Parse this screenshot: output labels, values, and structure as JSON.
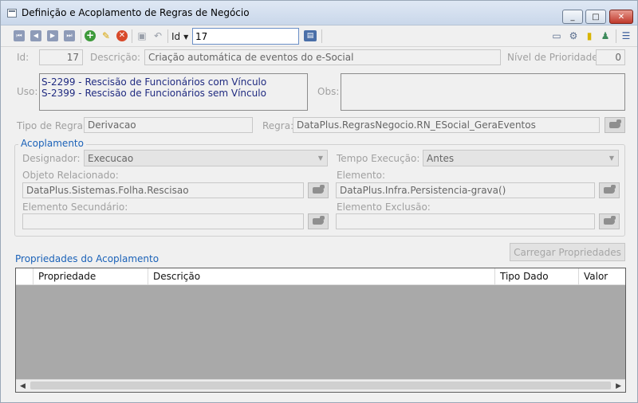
{
  "window": {
    "title": "Definição e Acoplamento de Regras de Negócio",
    "controls": {
      "minimize": "_",
      "maximize": "□",
      "close": "✕"
    }
  },
  "toolbar": {
    "search_field_label": "Id",
    "search_value": "17",
    "icons": [
      "first-record-icon",
      "previous-record-icon",
      "next-record-icon",
      "last-record-icon",
      "add-icon",
      "edit-icon",
      "delete-icon",
      "save-icon",
      "undo-icon",
      "search-go-icon",
      "export-icon",
      "settings-icon",
      "marker-icon",
      "user-icon",
      "panel-icon"
    ]
  },
  "form": {
    "id_label": "Id:",
    "id_value": "17",
    "descricao_label": "Descrição:",
    "descricao_value": "Criação automática de eventos do e-Social",
    "prioridade_label": "Nível de Prioridade:",
    "prioridade_value": "0",
    "uso_label": "Uso:",
    "uso_lines": [
      "S-2299 - Rescisão de Funcionários com Vínculo",
      "S-2399 - Rescisão de Funcionários sem Vínculo"
    ],
    "obs_label": "Obs:",
    "tipo_regra_label": "Tipo de Regra:",
    "tipo_regra_value": "Derivacao",
    "regra_label": "Regra:",
    "regra_value": "DataPlus.RegrasNegocio.RN_ESocial_GeraEventos"
  },
  "acoplamento": {
    "title": "Acoplamento",
    "designador_label": "Designador:",
    "designador_value": "Execucao",
    "tempo_label": "Tempo Execução:",
    "tempo_value": "Antes",
    "objeto_label": "Objeto Relacionado:",
    "objeto_value": "DataPlus.Sistemas.Folha.Rescisao",
    "elemento_label": "Elemento:",
    "elemento_value": "DataPlus.Infra.Persistencia-grava()",
    "secundario_label": "Elemento Secundário:",
    "secundario_value": "",
    "exclusao_label": "Elemento Exclusão:",
    "exclusao_value": ""
  },
  "propriedades": {
    "title": "Propriedades do Acoplamento",
    "load_button": "Carregar Propriedades",
    "columns": [
      "",
      "Propriedade",
      "Descrição",
      "Tipo Dado",
      "Valor"
    ],
    "rows": []
  },
  "colors": {
    "accent": "#1b62b8",
    "disabled_text": "#a0a0a0",
    "grid_empty": "#a9a9a9"
  }
}
